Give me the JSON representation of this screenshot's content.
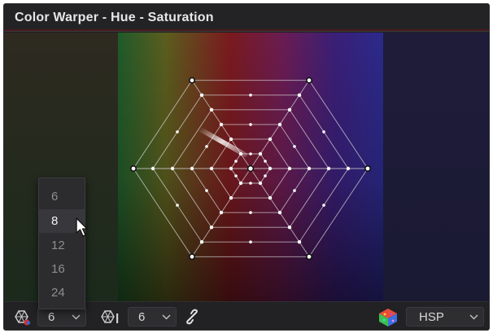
{
  "window": {
    "title": "Color Warper - Hue - Saturation"
  },
  "colors": {
    "panel_bg": "#1f1f22",
    "title_text": "#e6e6e6",
    "grid_line": "#d9d9d9",
    "handle_fill": "#ffffff"
  },
  "viewer": {
    "grid": "hexagonal spider-web mesh, 6 rings",
    "spokes": 6,
    "rings": 6
  },
  "footer": {
    "hue_points_icon": "hue-points-icon",
    "hue_points_value": "6",
    "saturation_points_icon": "saturation-points-icon",
    "saturation_points_value": "6",
    "link_icon": "link-icon",
    "color_cube_icon": "color-cube-icon",
    "color_space_value": "HSP"
  },
  "popup": {
    "options": [
      "6",
      "8",
      "12",
      "16",
      "24"
    ],
    "highlighted": "8"
  }
}
